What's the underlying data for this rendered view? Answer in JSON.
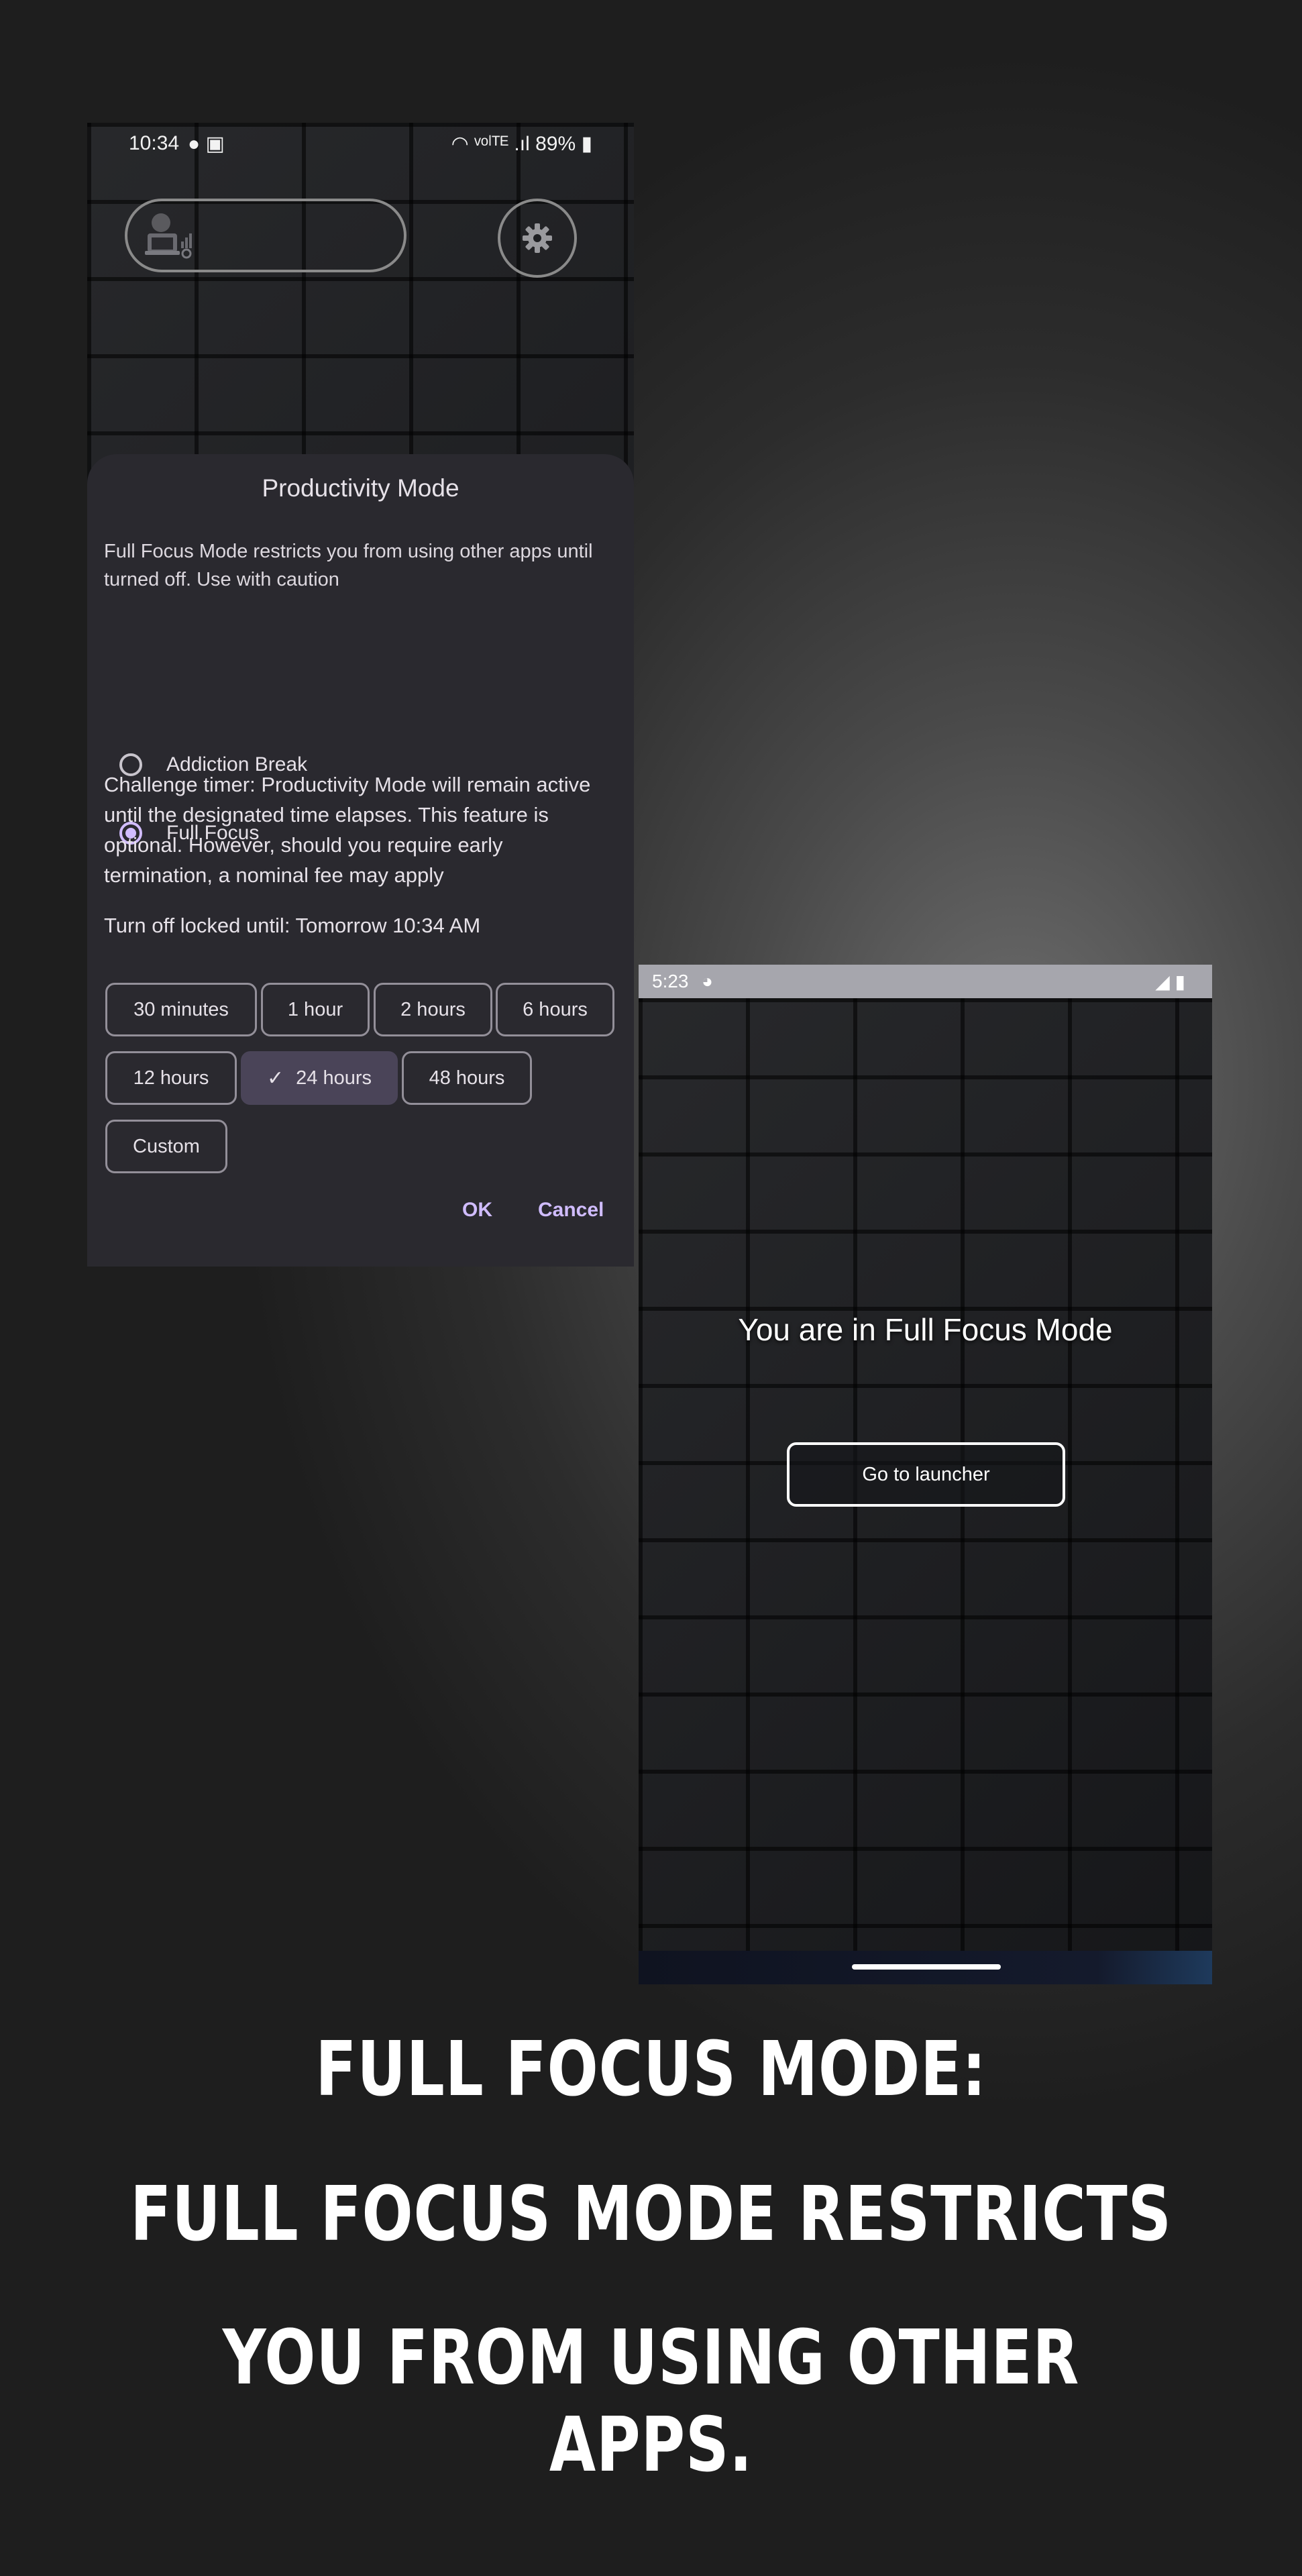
{
  "phone1": {
    "status": {
      "time": "10:34",
      "icons": "● ▣",
      "right": "◠ ᵛᵒˡᵀᴱ .ıl 89%",
      "battery": "▮"
    },
    "sheet": {
      "title": "Productivity Mode",
      "description": "Full Focus Mode restricts you from using other apps until turned off. Use with caution",
      "options": [
        {
          "label": "Addiction Break",
          "selected": false
        },
        {
          "label": "Full Focus",
          "selected": true
        }
      ],
      "challenge": "Challenge timer: Productivity Mode will remain active until the designated time elapses. This feature is optional. However, should you require early termination, a nominal fee may apply",
      "locked": "Turn off locked until: Tomorrow 10:34 AM",
      "durations": [
        {
          "label": "30 minutes"
        },
        {
          "label": "1 hour"
        },
        {
          "label": "2 hours"
        },
        {
          "label": "6 hours"
        },
        {
          "label": "12 hours"
        },
        {
          "label": "24 hours",
          "selected": true,
          "check": "✓"
        },
        {
          "label": "48 hours"
        },
        {
          "label": "Custom"
        }
      ],
      "ok": "OK",
      "cancel": "Cancel"
    }
  },
  "phone2": {
    "status": {
      "time": "5:23",
      "icon": "◕",
      "right": "◢ ▮"
    },
    "title": "You are in Full Focus Mode",
    "launcher_button": "Go to launcher"
  },
  "caption": {
    "line1": "FULL FOCUS MODE:",
    "line2": "FULL FOCUS MODE RESTRICTS",
    "line3": "YOU FROM USING OTHER APPS."
  },
  "colors": {
    "accent": "#d0bcff",
    "sheet_bg": "#2a292f",
    "chip_selected": "#4a4458"
  }
}
